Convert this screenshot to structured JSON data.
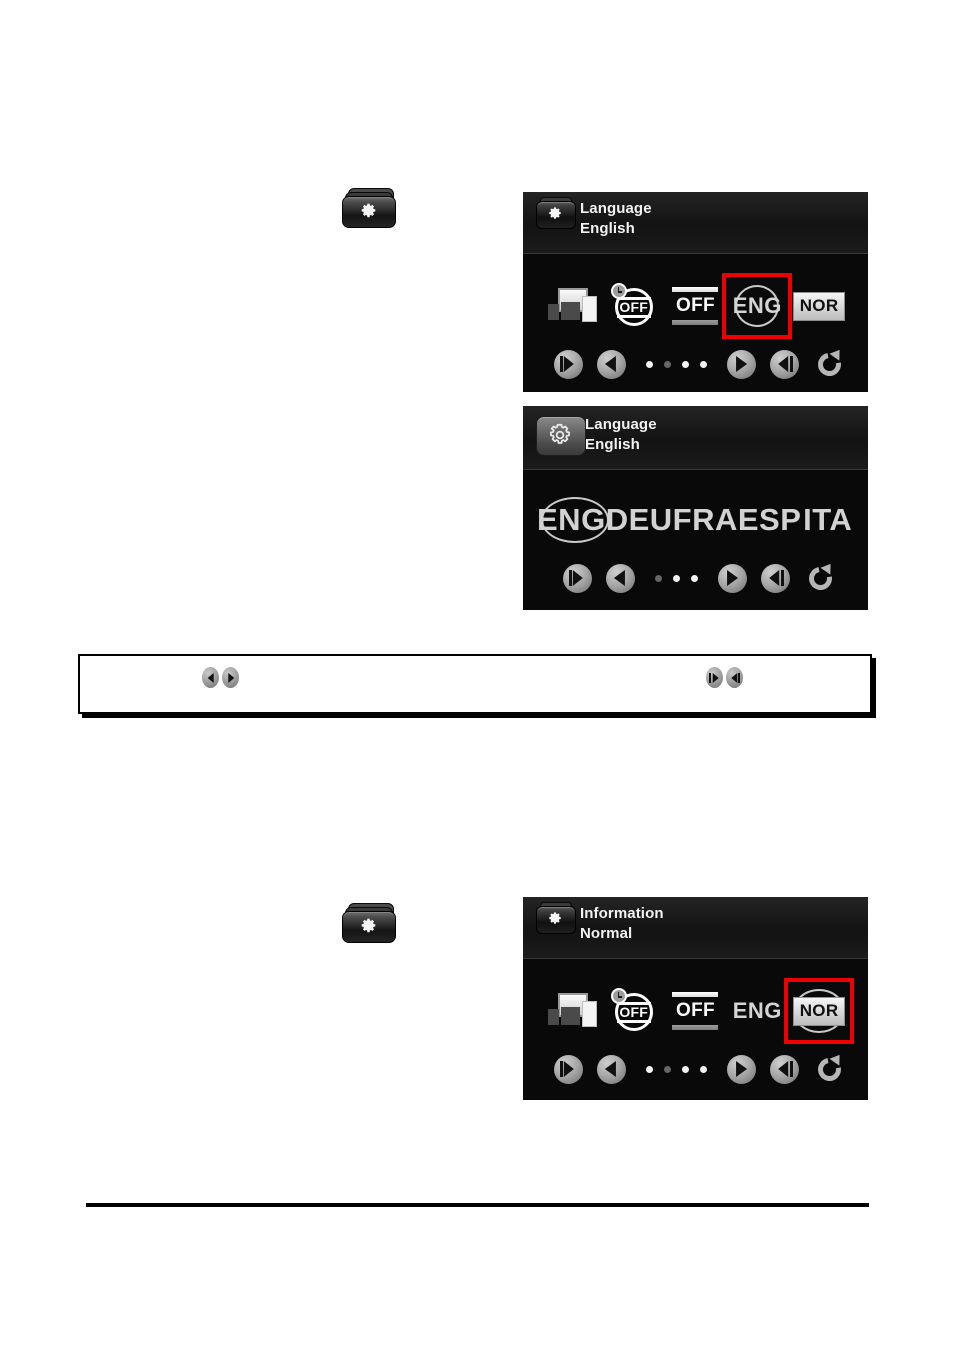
{
  "page": {
    "background": "#ffffff",
    "accent_red": "#ee0000",
    "panel_bg": "#0a0a0a"
  },
  "left_icons": [
    {
      "name": "settings-menu-icon",
      "glyph": "gear-icon",
      "step": 1
    },
    {
      "name": "settings-menu-icon",
      "glyph": "gear-icon",
      "step": 2
    }
  ],
  "panels": [
    {
      "id": "panel-language-menu",
      "header": {
        "icon": "gear-folder-icon",
        "icon_style": "filled-gear-dark-folder",
        "title": "Language",
        "value": "English"
      },
      "icon_row": [
        {
          "name": "printer-network-icon",
          "type": "printer",
          "label": "",
          "selected": false
        },
        {
          "name": "sleep-timer-off-icon",
          "type": "clock-off",
          "label": "OFF",
          "selected": false
        },
        {
          "name": "auto-off-icon",
          "type": "off-bars",
          "label": "OFF",
          "selected": false
        },
        {
          "name": "language-icon",
          "type": "lang-ring",
          "label": "ENG",
          "selected": true
        },
        {
          "name": "information-mode-icon",
          "type": "nor-chip",
          "label": "NOR",
          "selected": false
        }
      ],
      "nav": {
        "first_label": "first-page",
        "prev_label": "previous",
        "next_label": "next",
        "last_label": "last-page",
        "reset_label": "reset",
        "dots": [
          {
            "active": true
          },
          {
            "active": false
          },
          {
            "active": true
          },
          {
            "active": true
          }
        ]
      }
    },
    {
      "id": "panel-language-options",
      "header": {
        "icon": "gear-button-icon",
        "icon_style": "outline-gear-gray-button",
        "title": "Language",
        "value": "English"
      },
      "languages": [
        {
          "code": "ENG",
          "selected": true
        },
        {
          "code": "DEU",
          "selected": false
        },
        {
          "code": "FRA",
          "selected": false
        },
        {
          "code": "ESP",
          "selected": false
        },
        {
          "code": "ITA",
          "selected": false
        }
      ],
      "nav": {
        "first_label": "first-page",
        "prev_label": "previous",
        "next_label": "next",
        "last_label": "last-page",
        "reset_label": "reset",
        "dots": [
          {
            "active": false
          },
          {
            "active": true
          },
          {
            "active": true
          }
        ]
      }
    },
    {
      "id": "panel-information-menu",
      "header": {
        "icon": "gear-folder-icon",
        "icon_style": "filled-gear-dark-folder",
        "title": "Information",
        "value": "Normal"
      },
      "icon_row": [
        {
          "name": "printer-network-icon",
          "type": "printer",
          "label": "",
          "selected": false
        },
        {
          "name": "sleep-timer-off-icon",
          "type": "clock-off",
          "label": "OFF",
          "selected": false
        },
        {
          "name": "auto-off-icon",
          "type": "off-bars",
          "label": "OFF",
          "selected": false
        },
        {
          "name": "language-icon",
          "type": "lang-plain",
          "label": "ENG",
          "selected": false
        },
        {
          "name": "information-mode-icon",
          "type": "nor-ring",
          "label": "NOR",
          "selected": true
        }
      ],
      "nav": {
        "first_label": "first-page",
        "prev_label": "previous",
        "next_label": "next",
        "last_label": "last-page",
        "reset_label": "reset",
        "dots": [
          {
            "active": true
          },
          {
            "active": false
          },
          {
            "active": true
          },
          {
            "active": true
          }
        ]
      }
    }
  ],
  "note_box": {
    "text": "",
    "left_arrows": [
      {
        "name": "previous-arrow-icon",
        "dir": "prev"
      },
      {
        "name": "next-arrow-icon",
        "dir": "next"
      }
    ],
    "right_arrows": [
      {
        "name": "first-page-arrow-icon",
        "dir": "first"
      },
      {
        "name": "last-page-arrow-icon",
        "dir": "last"
      }
    ]
  }
}
